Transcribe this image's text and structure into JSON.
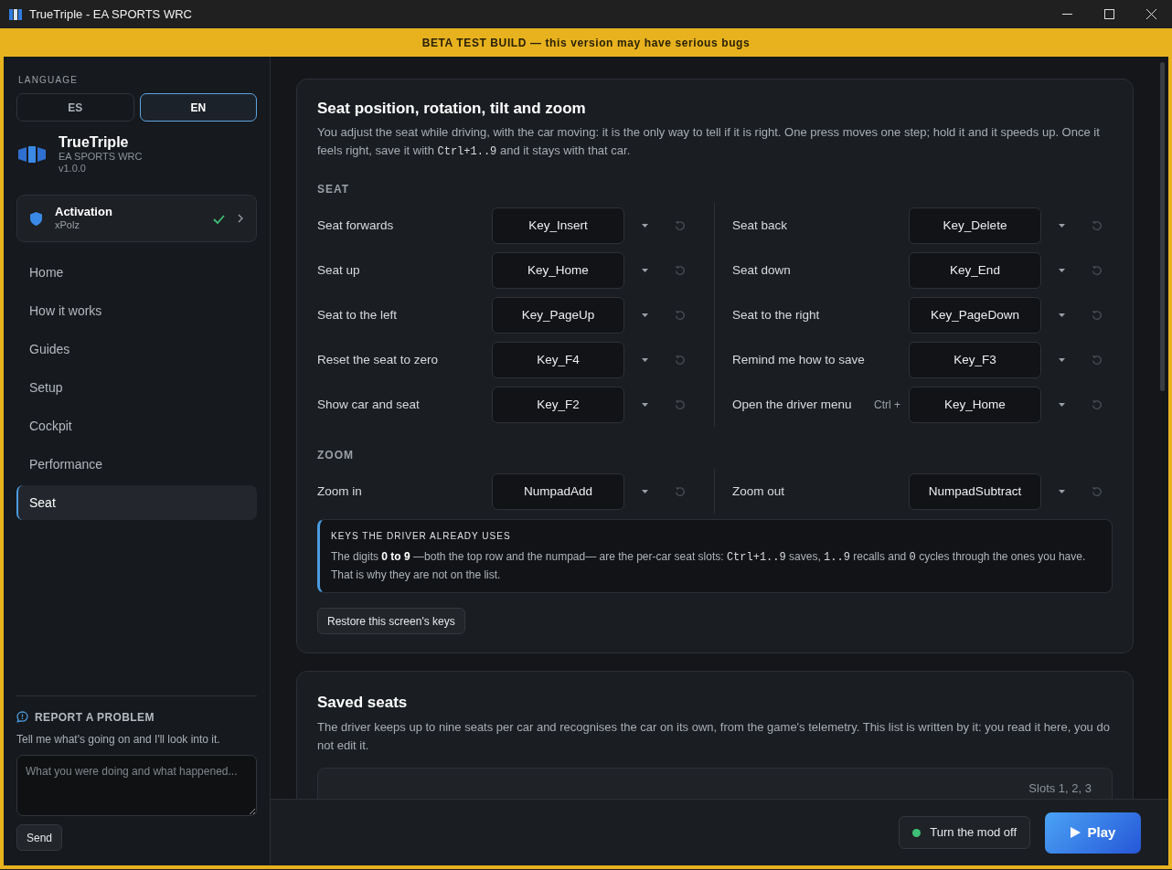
{
  "window": {
    "title": "TrueTriple - EA SPORTS WRC"
  },
  "banner": "BETA TEST BUILD — this version may have serious bugs",
  "sidebar": {
    "language_label": "LANGUAGE",
    "languages": [
      {
        "label": "ES",
        "selected": false
      },
      {
        "label": "EN",
        "selected": true
      }
    ],
    "app": {
      "name": "TrueTriple",
      "game": "EA SPORTS WRC",
      "version": "v1.0.0"
    },
    "activation": {
      "title": "Activation",
      "user": "xPolz",
      "verified": true
    },
    "nav": [
      {
        "label": "Home",
        "selected": false
      },
      {
        "label": "How it works",
        "selected": false
      },
      {
        "label": "Guides",
        "selected": false
      },
      {
        "label": "Setup",
        "selected": false
      },
      {
        "label": "Cockpit",
        "selected": false
      },
      {
        "label": "Performance",
        "selected": false
      },
      {
        "label": "Seat",
        "selected": true
      }
    ],
    "report": {
      "title": "REPORT A PROBLEM",
      "text": "Tell me what's going on and I'll look into it.",
      "placeholder": "What you were doing and what happened...",
      "send": "Send"
    }
  },
  "seat_card": {
    "title": "Seat position, rotation, tilt and zoom",
    "description": [
      {
        "kind": "text",
        "text": "You adjust the seat while driving, with the car moving: it is the only way to tell if it is right. One press moves one step; hold it and it speeds up. Once it feels right, save it with "
      },
      {
        "kind": "code",
        "text": "Ctrl+1..9"
      },
      {
        "kind": "text",
        "text": " and it stays with that car."
      }
    ],
    "groups": [
      {
        "title": "SEAT",
        "columns": [
          [
            {
              "label": "Seat forwards",
              "key": "Key_Insert"
            },
            {
              "label": "Seat up",
              "key": "Key_Home"
            },
            {
              "label": "Seat to the left",
              "key": "Key_PageUp"
            },
            {
              "label": "Reset the seat to zero",
              "key": "Key_F4"
            },
            {
              "label": "Show car and seat",
              "key": "Key_F2"
            }
          ],
          [
            {
              "label": "Seat back",
              "key": "Key_Delete"
            },
            {
              "label": "Seat down",
              "key": "Key_End"
            },
            {
              "label": "Seat to the right",
              "key": "Key_PageDown"
            },
            {
              "label": "Remind me how to save",
              "key": "Key_F3"
            },
            {
              "label": "Open the driver menu",
              "modifier": "Ctrl +",
              "key": "Key_Home"
            }
          ]
        ]
      },
      {
        "title": "ZOOM",
        "columns": [
          [
            {
              "label": "Zoom in",
              "key": "NumpadAdd"
            }
          ],
          [
            {
              "label": "Zoom out",
              "key": "NumpadSubtract"
            }
          ]
        ]
      }
    ],
    "note": {
      "title": "KEYS THE DRIVER ALREADY USES",
      "parts": [
        {
          "kind": "text",
          "text": "The digits **0 to 9** —both the top row and the numpad— are the per-car seat slots: "
        },
        {
          "kind": "code",
          "text": "Ctrl+1..9"
        },
        {
          "kind": "text",
          "text": " saves, "
        },
        {
          "kind": "code",
          "text": "1..9"
        },
        {
          "kind": "text",
          "text": " recalls and "
        },
        {
          "kind": "code",
          "text": "0"
        },
        {
          "kind": "text",
          "text": " cycles through the ones you have. That is why they are not on the list."
        }
      ]
    },
    "restore_button": "Restore this screen's keys"
  },
  "saved_card": {
    "title": "Saved seats",
    "description": "The driver keeps up to nine seats per car and recognises the car on its own, from the game's telemetry. This list is written by it: you read it here, you do not edit it.",
    "slots": "Slots 1, 2, 3"
  },
  "footer": {
    "mod_button": "Turn the mod off",
    "mod_active": true,
    "play_button": "Play"
  }
}
